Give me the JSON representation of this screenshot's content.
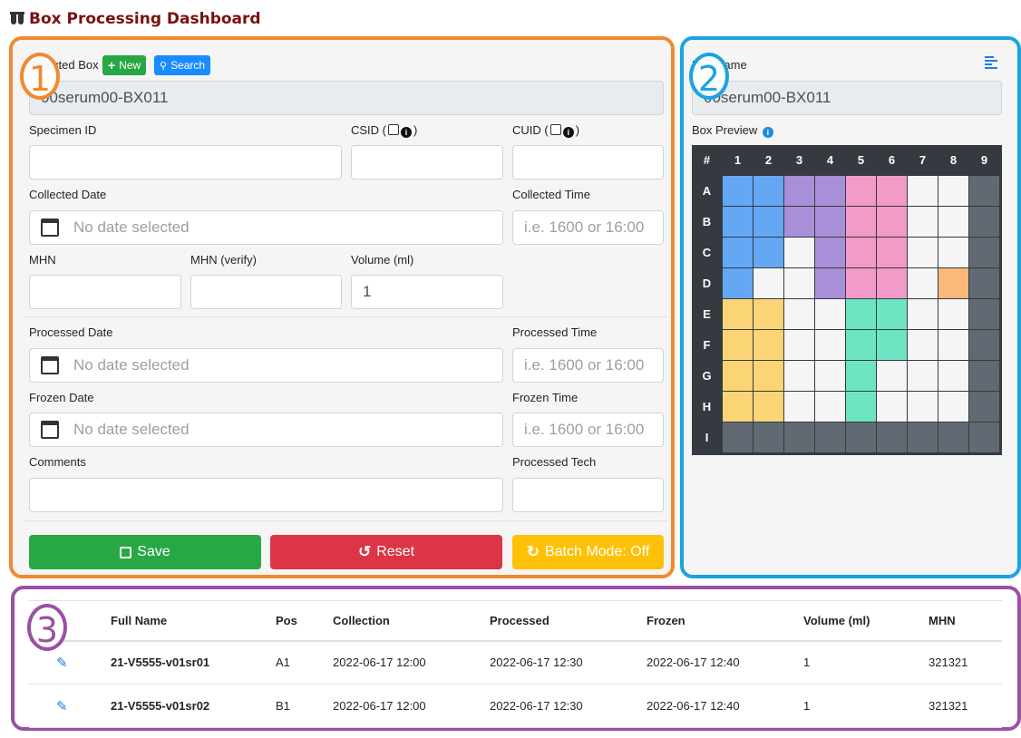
{
  "header": {
    "title": "Box Processing Dashboard",
    "icon": "test-tubes-icon"
  },
  "badges": {
    "one": "1",
    "two": "2",
    "three": "3"
  },
  "form": {
    "selected_box_label": "Selected Box",
    "new_label": "New",
    "search_label": "Search",
    "selected_box_value": "00serum00-BX011",
    "specimen_id_label": "Specimen ID",
    "csid_label_prefix": "CSID (",
    "csid_label_suffix": ")",
    "cuid_label_prefix": "CUID (",
    "cuid_label_suffix": ")",
    "collected_date_label": "Collected Date",
    "collected_time_label": "Collected Time",
    "date_placeholder": "No date selected",
    "time_placeholder": "i.e. 1600 or 16:00",
    "mhn_label": "MHN",
    "mhn_verify_label": "MHN (verify)",
    "volume_label": "Volume (ml)",
    "volume_value": "1",
    "processed_date_label": "Processed Date",
    "processed_time_label": "Processed Time",
    "frozen_date_label": "Frozen Date",
    "frozen_time_label": "Frozen Time",
    "comments_label": "Comments",
    "processed_tech_label": "Processed Tech",
    "save_label": "Save",
    "reset_label": "Reset",
    "batch_label": "Batch Mode: Off"
  },
  "box": {
    "name_label": "Box Name",
    "name_value": "00serum00-BX011",
    "preview_label": "Box Preview",
    "corner": "#",
    "columns": [
      "1",
      "2",
      "3",
      "4",
      "5",
      "6",
      "7",
      "8",
      "9"
    ],
    "rows": [
      "A",
      "B",
      "C",
      "D",
      "E",
      "F",
      "G",
      "H",
      "I"
    ],
    "colors": {
      "b": "#64a8f4",
      "p": "#a98fd8",
      "k": "#f29bc8",
      "y": "#fbd575",
      "g": "#6ee5c2",
      "o": "#fbb87a",
      "w": "#f5f5f5",
      "d": "#616a72"
    },
    "grid": [
      "bbppkkwwd",
      "bbppkkwwd",
      "bbwpkkwwd",
      "bwwpkkwod",
      "yywwggwwd",
      "yywwggwwd",
      "yywwgwwwd",
      "yywwgwwwd",
      "ddddddddd"
    ]
  },
  "table": {
    "headers": [
      "",
      "Full Name",
      "Pos",
      "Collection",
      "Processed",
      "Frozen",
      "Volume (ml)",
      "MHN"
    ],
    "rows": [
      [
        "21-V5555-v01sr01",
        "A1",
        "2022-06-17 12:00",
        "2022-06-17 12:30",
        "2022-06-17 12:40",
        "1",
        "321321"
      ],
      [
        "21-V5555-v01sr02",
        "B1",
        "2022-06-17 12:00",
        "2022-06-17 12:30",
        "2022-06-17 12:40",
        "1",
        "321321"
      ]
    ]
  }
}
